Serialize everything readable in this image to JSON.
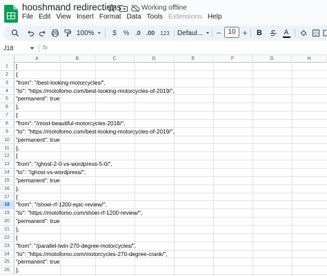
{
  "app": {
    "doc_title": "hooshmand redirections",
    "status": "Working offline",
    "menu": [
      "File",
      "Edit",
      "View",
      "Insert",
      "Format",
      "Data",
      "Tools",
      "Extensions",
      "Help"
    ]
  },
  "toolbar": {
    "zoom": "100%",
    "currency": "$",
    "percent": "%",
    "decrease_decimal": ".0",
    "increase_decimal": ".00",
    "number_format": "123",
    "font": "Defaul...",
    "font_size": "10",
    "bold": "B",
    "text_color": "A",
    "minus": "−",
    "plus": "+"
  },
  "formula_bar": {
    "cell_ref": "J18",
    "fx": "fx"
  },
  "sheet": {
    "columns": [
      "A",
      "B",
      "C",
      "D",
      "E",
      "F",
      "G",
      "H"
    ],
    "selected_row": 18,
    "rows": [
      {
        "num": "1",
        "a": "["
      },
      {
        "num": "2",
        "a": "{"
      },
      {
        "num": "3",
        "a": "\"from\": \"/best-looking-motorcycles/\","
      },
      {
        "num": "4",
        "a": "\"to\": \"https://motofomo.com/best-looking-motorcycles-of-2019/\","
      },
      {
        "num": "5",
        "a": "\"permanent\": true"
      },
      {
        "num": "6",
        "a": "},"
      },
      {
        "num": "7",
        "a": "{"
      },
      {
        "num": "8",
        "a": "\"from\": \"/most-beautiful-motorcycles-2018/\","
      },
      {
        "num": "9",
        "a": "\"to\": \"https://motofomo.com/best-looking-motorcycles-of-2019/\","
      },
      {
        "num": "10",
        "a": "\"permanent\": true"
      },
      {
        "num": "11",
        "a": "},"
      },
      {
        "num": "12",
        "a": "{"
      },
      {
        "num": "13",
        "a": "\"from\": \"/ghost-2-0-vs-wordpress-5-0/\","
      },
      {
        "num": "14",
        "a": "\"to\": \"/ghost-vs-wordpress/\","
      },
      {
        "num": "15",
        "a": "\"permanent\": true"
      },
      {
        "num": "16",
        "a": "},"
      },
      {
        "num": "17",
        "a": "{"
      },
      {
        "num": "18",
        "a": "\"from\": \"/shoei-rf-1200-epic-review/\","
      },
      {
        "num": "19",
        "a": "\"to\": \"https://motofomo.com/shoei-rf-1200-review/\","
      },
      {
        "num": "20",
        "a": "\"permanent\": true"
      },
      {
        "num": "21",
        "a": "},"
      },
      {
        "num": "22",
        "a": "{"
      },
      {
        "num": "23",
        "a": "\"from\": \"/parallel-twin-270-degree-motorcycles/\","
      },
      {
        "num": "24",
        "a": "\"to\": \"https://motofomo.com/motorcycles-270-degree-crank/\","
      },
      {
        "num": "25",
        "a": "\"permanent\": true"
      },
      {
        "num": "26",
        "a": "},"
      }
    ]
  },
  "colors": {
    "accent": "#0b57d0",
    "toolbar_bg": "#edf2fa",
    "sheets_green": "#0f9d58"
  }
}
